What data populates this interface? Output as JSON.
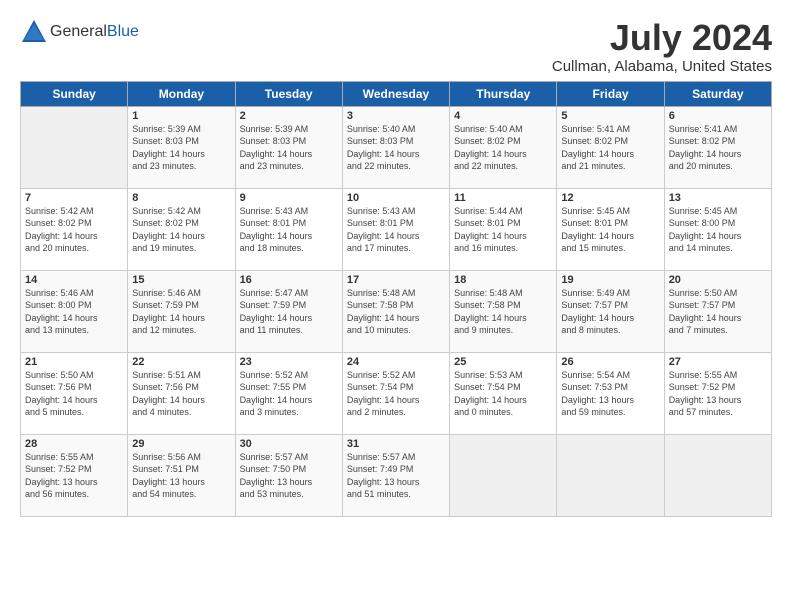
{
  "logo": {
    "general": "General",
    "blue": "Blue"
  },
  "header": {
    "month_year": "July 2024",
    "location": "Cullman, Alabama, United States"
  },
  "days_of_week": [
    "Sunday",
    "Monday",
    "Tuesday",
    "Wednesday",
    "Thursday",
    "Friday",
    "Saturday"
  ],
  "weeks": [
    [
      {
        "day": "",
        "sunrise": "",
        "sunset": "",
        "daylight": ""
      },
      {
        "day": "1",
        "sunrise": "Sunrise: 5:39 AM",
        "sunset": "Sunset: 8:03 PM",
        "daylight": "Daylight: 14 hours and 23 minutes."
      },
      {
        "day": "2",
        "sunrise": "Sunrise: 5:39 AM",
        "sunset": "Sunset: 8:03 PM",
        "daylight": "Daylight: 14 hours and 23 minutes."
      },
      {
        "day": "3",
        "sunrise": "Sunrise: 5:40 AM",
        "sunset": "Sunset: 8:03 PM",
        "daylight": "Daylight: 14 hours and 22 minutes."
      },
      {
        "day": "4",
        "sunrise": "Sunrise: 5:40 AM",
        "sunset": "Sunset: 8:02 PM",
        "daylight": "Daylight: 14 hours and 22 minutes."
      },
      {
        "day": "5",
        "sunrise": "Sunrise: 5:41 AM",
        "sunset": "Sunset: 8:02 PM",
        "daylight": "Daylight: 14 hours and 21 minutes."
      },
      {
        "day": "6",
        "sunrise": "Sunrise: 5:41 AM",
        "sunset": "Sunset: 8:02 PM",
        "daylight": "Daylight: 14 hours and 20 minutes."
      }
    ],
    [
      {
        "day": "7",
        "sunrise": "Sunrise: 5:42 AM",
        "sunset": "Sunset: 8:02 PM",
        "daylight": "Daylight: 14 hours and 20 minutes."
      },
      {
        "day": "8",
        "sunrise": "Sunrise: 5:42 AM",
        "sunset": "Sunset: 8:02 PM",
        "daylight": "Daylight: 14 hours and 19 minutes."
      },
      {
        "day": "9",
        "sunrise": "Sunrise: 5:43 AM",
        "sunset": "Sunset: 8:01 PM",
        "daylight": "Daylight: 14 hours and 18 minutes."
      },
      {
        "day": "10",
        "sunrise": "Sunrise: 5:43 AM",
        "sunset": "Sunset: 8:01 PM",
        "daylight": "Daylight: 14 hours and 17 minutes."
      },
      {
        "day": "11",
        "sunrise": "Sunrise: 5:44 AM",
        "sunset": "Sunset: 8:01 PM",
        "daylight": "Daylight: 14 hours and 16 minutes."
      },
      {
        "day": "12",
        "sunrise": "Sunrise: 5:45 AM",
        "sunset": "Sunset: 8:01 PM",
        "daylight": "Daylight: 14 hours and 15 minutes."
      },
      {
        "day": "13",
        "sunrise": "Sunrise: 5:45 AM",
        "sunset": "Sunset: 8:00 PM",
        "daylight": "Daylight: 14 hours and 14 minutes."
      }
    ],
    [
      {
        "day": "14",
        "sunrise": "Sunrise: 5:46 AM",
        "sunset": "Sunset: 8:00 PM",
        "daylight": "Daylight: 14 hours and 13 minutes."
      },
      {
        "day": "15",
        "sunrise": "Sunrise: 5:46 AM",
        "sunset": "Sunset: 7:59 PM",
        "daylight": "Daylight: 14 hours and 12 minutes."
      },
      {
        "day": "16",
        "sunrise": "Sunrise: 5:47 AM",
        "sunset": "Sunset: 7:59 PM",
        "daylight": "Daylight: 14 hours and 11 minutes."
      },
      {
        "day": "17",
        "sunrise": "Sunrise: 5:48 AM",
        "sunset": "Sunset: 7:58 PM",
        "daylight": "Daylight: 14 hours and 10 minutes."
      },
      {
        "day": "18",
        "sunrise": "Sunrise: 5:48 AM",
        "sunset": "Sunset: 7:58 PM",
        "daylight": "Daylight: 14 hours and 9 minutes."
      },
      {
        "day": "19",
        "sunrise": "Sunrise: 5:49 AM",
        "sunset": "Sunset: 7:57 PM",
        "daylight": "Daylight: 14 hours and 8 minutes."
      },
      {
        "day": "20",
        "sunrise": "Sunrise: 5:50 AM",
        "sunset": "Sunset: 7:57 PM",
        "daylight": "Daylight: 14 hours and 7 minutes."
      }
    ],
    [
      {
        "day": "21",
        "sunrise": "Sunrise: 5:50 AM",
        "sunset": "Sunset: 7:56 PM",
        "daylight": "Daylight: 14 hours and 5 minutes."
      },
      {
        "day": "22",
        "sunrise": "Sunrise: 5:51 AM",
        "sunset": "Sunset: 7:56 PM",
        "daylight": "Daylight: 14 hours and 4 minutes."
      },
      {
        "day": "23",
        "sunrise": "Sunrise: 5:52 AM",
        "sunset": "Sunset: 7:55 PM",
        "daylight": "Daylight: 14 hours and 3 minutes."
      },
      {
        "day": "24",
        "sunrise": "Sunrise: 5:52 AM",
        "sunset": "Sunset: 7:54 PM",
        "daylight": "Daylight: 14 hours and 2 minutes."
      },
      {
        "day": "25",
        "sunrise": "Sunrise: 5:53 AM",
        "sunset": "Sunset: 7:54 PM",
        "daylight": "Daylight: 14 hours and 0 minutes."
      },
      {
        "day": "26",
        "sunrise": "Sunrise: 5:54 AM",
        "sunset": "Sunset: 7:53 PM",
        "daylight": "Daylight: 13 hours and 59 minutes."
      },
      {
        "day": "27",
        "sunrise": "Sunrise: 5:55 AM",
        "sunset": "Sunset: 7:52 PM",
        "daylight": "Daylight: 13 hours and 57 minutes."
      }
    ],
    [
      {
        "day": "28",
        "sunrise": "Sunrise: 5:55 AM",
        "sunset": "Sunset: 7:52 PM",
        "daylight": "Daylight: 13 hours and 56 minutes."
      },
      {
        "day": "29",
        "sunrise": "Sunrise: 5:56 AM",
        "sunset": "Sunset: 7:51 PM",
        "daylight": "Daylight: 13 hours and 54 minutes."
      },
      {
        "day": "30",
        "sunrise": "Sunrise: 5:57 AM",
        "sunset": "Sunset: 7:50 PM",
        "daylight": "Daylight: 13 hours and 53 minutes."
      },
      {
        "day": "31",
        "sunrise": "Sunrise: 5:57 AM",
        "sunset": "Sunset: 7:49 PM",
        "daylight": "Daylight: 13 hours and 51 minutes."
      },
      {
        "day": "",
        "sunrise": "",
        "sunset": "",
        "daylight": ""
      },
      {
        "day": "",
        "sunrise": "",
        "sunset": "",
        "daylight": ""
      },
      {
        "day": "",
        "sunrise": "",
        "sunset": "",
        "daylight": ""
      }
    ]
  ]
}
